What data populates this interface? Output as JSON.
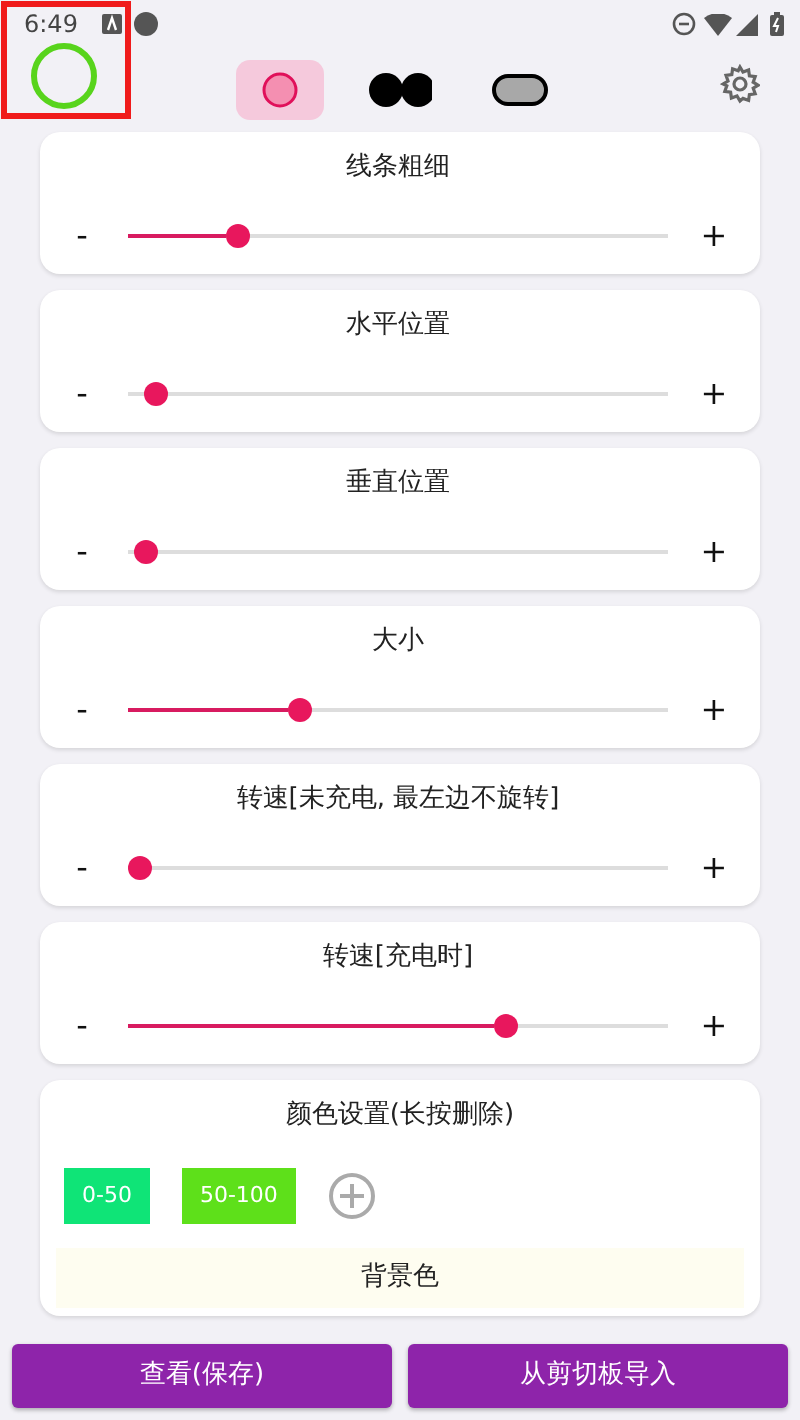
{
  "status_bar": {
    "time": "6:49"
  },
  "style_tabs": [
    {
      "kind": "ring",
      "selected": true
    },
    {
      "kind": "dots",
      "selected": false
    },
    {
      "kind": "pill",
      "selected": false
    }
  ],
  "sliders": [
    {
      "title": "线条粗细",
      "minus": "-",
      "plus": "+",
      "level": 0.19
    },
    {
      "title": "水平位置",
      "minus": "-",
      "plus": "+",
      "level": 0.03
    },
    {
      "title": "垂直位置",
      "minus": "-",
      "plus": "+",
      "level": 0.01
    },
    {
      "title": "大小",
      "minus": "-",
      "plus": "+",
      "level": 0.31
    },
    {
      "title": "转速[未充电, 最左边不旋转]",
      "minus": "-",
      "plus": "+",
      "level": 0.0
    },
    {
      "title": "转速[充电时]",
      "minus": "-",
      "plus": "+",
      "level": 0.71
    }
  ],
  "color_settings": {
    "title": "颜色设置(长按删除)",
    "ranges": [
      {
        "label": "0-50",
        "color": "#0fe477"
      },
      {
        "label": "50-100",
        "color": "#5ee01a"
      }
    ],
    "background_label": "背景色"
  },
  "buttons": [
    "查看(保存)",
    "从剪切板导入"
  ]
}
